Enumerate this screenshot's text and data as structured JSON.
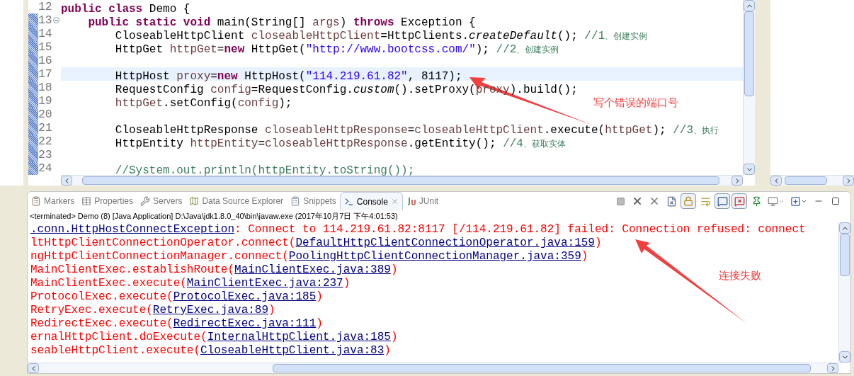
{
  "editor": {
    "lines": [
      {
        "number": "12",
        "changed": false,
        "current": false,
        "tokens": [
          {
            "kind": "keyword",
            "text": "public"
          },
          {
            "kind": "keyword",
            "text": " class"
          },
          {
            "kind": "plain",
            "text": " Demo {"
          }
        ]
      },
      {
        "number": "13",
        "changed": true,
        "fold": true,
        "current": false,
        "tokens": [
          {
            "kind": "keyword",
            "text": "    public"
          },
          {
            "kind": "keyword",
            "text": " static"
          },
          {
            "kind": "keyword",
            "text": " void"
          },
          {
            "kind": "plain",
            "text": " main(String[] "
          },
          {
            "kind": "variable",
            "text": "args"
          },
          {
            "kind": "plain",
            "text": ") "
          },
          {
            "kind": "keyword",
            "text": "throws"
          },
          {
            "kind": "plain",
            "text": " Exception {"
          }
        ]
      },
      {
        "number": "14",
        "changed": true,
        "current": false,
        "tokens": [
          {
            "kind": "plain",
            "text": "        CloseableHttpClient "
          },
          {
            "kind": "variable",
            "text": "closeableHttpClient"
          },
          {
            "kind": "plain",
            "text": "=HttpClients."
          },
          {
            "kind": "italic",
            "text": "createDefault"
          },
          {
            "kind": "plain",
            "text": "(); "
          },
          {
            "kind": "comment",
            "text": "//1、创建实例"
          }
        ]
      },
      {
        "number": "15",
        "changed": true,
        "current": false,
        "tokens": [
          {
            "kind": "plain",
            "text": "        HttpGet "
          },
          {
            "kind": "variable",
            "text": "httpGet"
          },
          {
            "kind": "plain",
            "text": "="
          },
          {
            "kind": "keyword",
            "text": "new"
          },
          {
            "kind": "plain",
            "text": " HttpGet("
          },
          {
            "kind": "string",
            "text": "\"http://www.bootcss.com/\""
          },
          {
            "kind": "plain",
            "text": "); "
          },
          {
            "kind": "comment",
            "text": "//2、创建实例"
          }
        ]
      },
      {
        "number": "16",
        "changed": true,
        "current": false
      },
      {
        "number": "17",
        "changed": true,
        "current": true,
        "tokens": [
          {
            "kind": "plain",
            "text": "        HttpHost "
          },
          {
            "kind": "variable",
            "text": "proxy"
          },
          {
            "kind": "plain",
            "text": "="
          },
          {
            "kind": "keyword",
            "text": "new"
          },
          {
            "kind": "plain",
            "text": " HttpHost("
          },
          {
            "kind": "string",
            "text": "\"114.219.61.82\""
          },
          {
            "kind": "plain",
            "text": ", 8117);"
          }
        ]
      },
      {
        "number": "18",
        "changed": true,
        "current": false,
        "tokens": [
          {
            "kind": "plain",
            "text": "        RequestConfig "
          },
          {
            "kind": "variable",
            "text": "config"
          },
          {
            "kind": "plain",
            "text": "=RequestConfig."
          },
          {
            "kind": "italic",
            "text": "custom"
          },
          {
            "kind": "plain",
            "text": "().setProxy("
          },
          {
            "kind": "variable",
            "text": "proxy"
          },
          {
            "kind": "plain",
            "text": ").build();"
          }
        ]
      },
      {
        "number": "19",
        "changed": true,
        "current": false,
        "tokens": [
          {
            "kind": "variable",
            "text": "        httpGet"
          },
          {
            "kind": "plain",
            "text": ".setConfig("
          },
          {
            "kind": "variable",
            "text": "config"
          },
          {
            "kind": "plain",
            "text": ");"
          }
        ]
      },
      {
        "number": "20",
        "changed": true,
        "current": false
      },
      {
        "number": "21",
        "changed": true,
        "current": false,
        "tokens": [
          {
            "kind": "plain",
            "text": "        CloseableHttpResponse "
          },
          {
            "kind": "variable",
            "text": "closeableHttpResponse"
          },
          {
            "kind": "plain",
            "text": "="
          },
          {
            "kind": "variable",
            "text": "closeableHttpClient"
          },
          {
            "kind": "plain",
            "text": ".execute("
          },
          {
            "kind": "variable",
            "text": "httpGet"
          },
          {
            "kind": "plain",
            "text": "); "
          },
          {
            "kind": "comment",
            "text": "//3、执行"
          }
        ]
      },
      {
        "number": "22",
        "changed": true,
        "current": false,
        "tokens": [
          {
            "kind": "plain",
            "text": "        HttpEntity "
          },
          {
            "kind": "variable",
            "text": "httpEntity"
          },
          {
            "kind": "plain",
            "text": "="
          },
          {
            "kind": "variable",
            "text": "closeableHttpResponse"
          },
          {
            "kind": "plain",
            "text": ".getEntity(); "
          },
          {
            "kind": "comment",
            "text": "//4、获取实体"
          }
        ]
      },
      {
        "number": "23",
        "changed": true,
        "current": false
      },
      {
        "number": "24",
        "changed": true,
        "current": false,
        "tokens": [
          {
            "kind": "comment",
            "text": "        //System.out.println(httpEntity.toString());"
          }
        ]
      }
    ]
  },
  "console": {
    "tabs": [
      {
        "kind": "markers",
        "label": "Markers",
        "selected": false,
        "closable": false
      },
      {
        "kind": "properties",
        "label": "Properties",
        "selected": false,
        "closable": false
      },
      {
        "kind": "servers",
        "label": "Servers",
        "selected": false,
        "closable": false
      },
      {
        "kind": "datasource",
        "label": "Data Source Explorer",
        "selected": false,
        "closable": false
      },
      {
        "kind": "snippets",
        "label": "Snippets",
        "selected": false,
        "closable": false
      },
      {
        "kind": "console",
        "label": "Console",
        "selected": true,
        "closable": true
      },
      {
        "kind": "junit",
        "label": "JUnit",
        "selected": false,
        "closable": false
      }
    ],
    "toolbar": [
      {
        "kind": "stop",
        "pressed": false
      },
      {
        "kind": "remove",
        "pressed": false
      },
      {
        "kind": "remove_all",
        "pressed": false
      },
      {
        "kind": "clear",
        "pressed": false
      },
      {
        "kind": "scroll_lock",
        "pressed": true
      },
      {
        "kind": "word_wrap",
        "pressed": false
      },
      {
        "kind": "stdout",
        "pressed": true
      },
      {
        "kind": "stderr",
        "pressed": true
      },
      {
        "kind": "pin",
        "pressed": false
      },
      {
        "kind": "display",
        "pressed": false
      },
      {
        "kind": "open",
        "pressed": false
      },
      {
        "kind": "minimize",
        "pressed": false
      },
      {
        "kind": "maximize",
        "pressed": false
      }
    ],
    "status": "<terminated> Demo (8) [Java Application] D:\\Java\\jdk1.8.0_40\\bin\\javaw.exe (2017年10月7日 下午4:01:53)",
    "lines": [
      {
        "segments": [
          {
            "kind": "link",
            "text": ".conn.HttpHostConnectException"
          },
          {
            "kind": "error",
            "text": ": Connect to 114.219.61.82:8117 [/114.219.61.82] failed: Connection refused: connect"
          }
        ]
      },
      {
        "segments": [
          {
            "kind": "error",
            "text": "ltHttpClientConnectionOperator.connect("
          },
          {
            "kind": "link",
            "text": "DefaultHttpClientConnectionOperator.java:159"
          },
          {
            "kind": "error",
            "text": ")"
          }
        ]
      },
      {
        "segments": [
          {
            "kind": "error",
            "text": "ngHttpClientConnectionManager.connect("
          },
          {
            "kind": "link",
            "text": "PoolingHttpClientConnectionManager.java:359"
          },
          {
            "kind": "error",
            "text": ")"
          }
        ]
      },
      {
        "segments": [
          {
            "kind": "error",
            "text": "MainClientExec.establishRoute("
          },
          {
            "kind": "link",
            "text": "MainClientExec.java:389"
          },
          {
            "kind": "error",
            "text": ")"
          }
        ]
      },
      {
        "segments": [
          {
            "kind": "error",
            "text": "MainClientExec.execute("
          },
          {
            "kind": "link",
            "text": "MainClientExec.java:237"
          },
          {
            "kind": "error",
            "text": ")"
          }
        ]
      },
      {
        "segments": [
          {
            "kind": "error",
            "text": "ProtocolExec.execute("
          },
          {
            "kind": "link",
            "text": "ProtocolExec.java:185"
          },
          {
            "kind": "error",
            "text": ")"
          }
        ]
      },
      {
        "segments": [
          {
            "kind": "error",
            "text": "RetryExec.execute("
          },
          {
            "kind": "link",
            "text": "RetryExec.java:89"
          },
          {
            "kind": "error",
            "text": ")"
          }
        ]
      },
      {
        "segments": [
          {
            "kind": "error",
            "text": "RedirectExec.execute("
          },
          {
            "kind": "link",
            "text": "RedirectExec.java:111"
          },
          {
            "kind": "error",
            "text": ")"
          }
        ]
      },
      {
        "segments": [
          {
            "kind": "error",
            "text": "ernalHttpClient.doExecute("
          },
          {
            "kind": "link",
            "text": "InternalHttpClient.java:185"
          },
          {
            "kind": "error",
            "text": ")"
          }
        ]
      },
      {
        "segments": [
          {
            "kind": "error",
            "text": "seableHttpClient.execute("
          },
          {
            "kind": "link",
            "text": "CloseableHttpClient.java:83"
          },
          {
            "kind": "error",
            "text": ")"
          }
        ]
      }
    ]
  },
  "annotations": [
    {
      "text": "写个错误的端口号"
    },
    {
      "text": "连接失败"
    }
  ]
}
